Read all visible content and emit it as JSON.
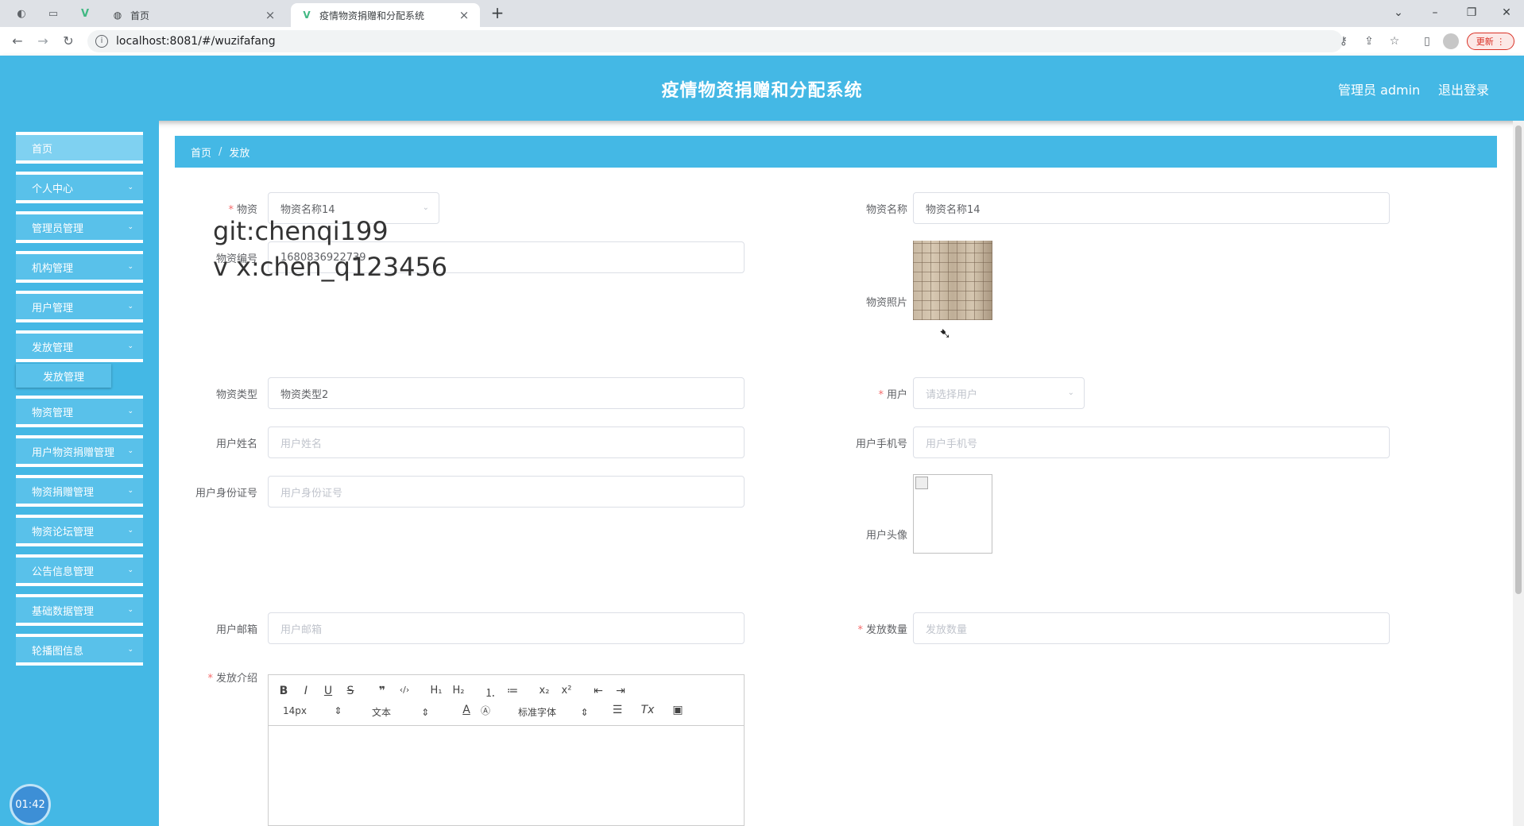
{
  "browser": {
    "tabs": [
      {
        "title": "首页"
      },
      {
        "title": "疫情物资捐赠和分配系统"
      }
    ],
    "url": "localhost:8081/#/wuzifafang",
    "update_label": "更新"
  },
  "header": {
    "title": "疫情物资捐赠和分配系统",
    "user": "管理员 admin",
    "logout": "退出登录"
  },
  "sidebar": {
    "items": [
      {
        "label": "首页"
      },
      {
        "label": "个人中心"
      },
      {
        "label": "管理员管理"
      },
      {
        "label": "机构管理"
      },
      {
        "label": "用户管理"
      },
      {
        "label": "发放管理"
      },
      {
        "label": "物资管理"
      },
      {
        "label": "用户物资捐赠管理"
      },
      {
        "label": "物资捐赠管理"
      },
      {
        "label": "物资论坛管理"
      },
      {
        "label": "公告信息管理"
      },
      {
        "label": "基础数据管理"
      },
      {
        "label": "轮播图信息"
      }
    ],
    "submenu_label": "发放管理",
    "timer": "01:42"
  },
  "breadcrumb": {
    "home": "首页",
    "current": "发放"
  },
  "form": {
    "wuzi_label": "物资",
    "wuzi_value": "物资名称14",
    "wuzi_name_label": "物资名称",
    "wuzi_name_value": "物资名称14",
    "wuzi_code_label": "物资编号",
    "wuzi_code_value": "1680836922739",
    "wuzi_photo_label": "物资照片",
    "wuzi_type_label": "物资类型",
    "wuzi_type_value": "物资类型2",
    "user_label": "用户",
    "user_placeholder": "请选择用户",
    "user_name_label": "用户姓名",
    "user_name_placeholder": "用户姓名",
    "user_phone_label": "用户手机号",
    "user_phone_placeholder": "用户手机号",
    "user_id_label": "用户身份证号",
    "user_id_placeholder": "用户身份证号",
    "user_avatar_label": "用户头像",
    "user_email_label": "用户邮箱",
    "user_email_placeholder": "用户邮箱",
    "qty_label": "发放数量",
    "qty_placeholder": "发放数量",
    "intro_label": "发放介绍",
    "required_mark": "*"
  },
  "editor": {
    "font_size": "14px",
    "heading": "文本",
    "font_family": "标准字体"
  },
  "watermark": {
    "line1": "git:chenqi199",
    "line2": "v x:chen_q123456"
  }
}
